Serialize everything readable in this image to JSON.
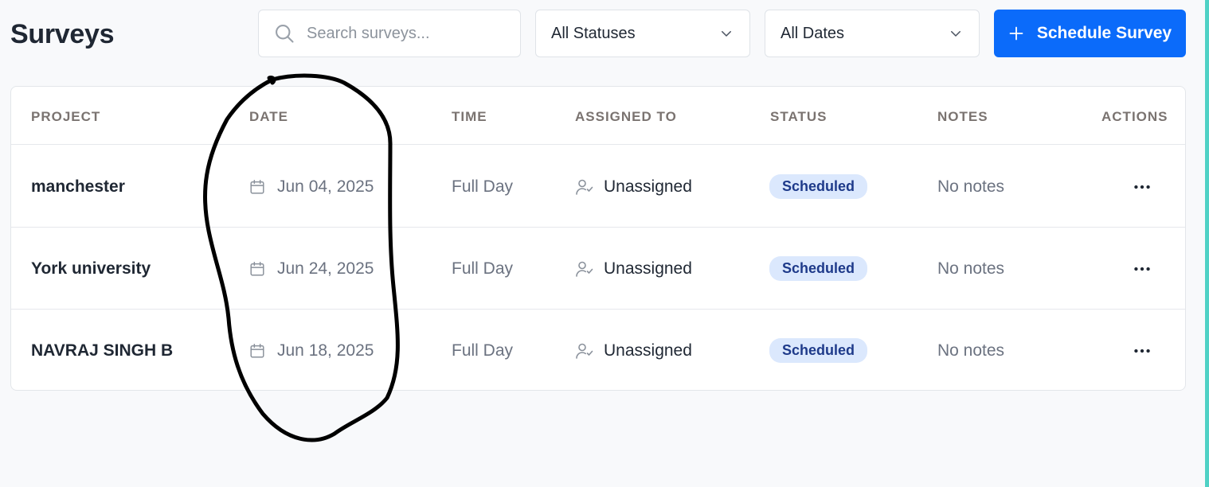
{
  "header": {
    "title": "Surveys",
    "search_placeholder": "Search surveys...",
    "status_filter": "All Statuses",
    "date_filter": "All Dates",
    "schedule_button": "Schedule Survey"
  },
  "table": {
    "columns": [
      "PROJECT",
      "DATE",
      "TIME",
      "ASSIGNED TO",
      "STATUS",
      "NOTES",
      "ACTIONS"
    ],
    "rows": [
      {
        "project": "manchester",
        "date": "Jun 04, 2025",
        "time": "Full Day",
        "assigned": "Unassigned",
        "status": "Scheduled",
        "notes": "No notes"
      },
      {
        "project": "York university",
        "date": "Jun 24, 2025",
        "time": "Full Day",
        "assigned": "Unassigned",
        "status": "Scheduled",
        "notes": "No notes"
      },
      {
        "project": "NAVRAJ SINGH B",
        "date": "Jun 18, 2025",
        "time": "Full Day",
        "assigned": "Unassigned",
        "status": "Scheduled",
        "notes": "No notes"
      }
    ]
  },
  "icons": {
    "search": "search-icon",
    "dropdown": "chevron-down-icon",
    "add": "plus-icon",
    "date": "calendar-icon",
    "assignee": "user-check-icon",
    "actions": "more-horizontal-icon"
  },
  "colors": {
    "accent": "#0b6bfa",
    "badge_bg": "#dbe8fd",
    "badge_text": "#1e3a8a",
    "annotation": "#000000"
  }
}
